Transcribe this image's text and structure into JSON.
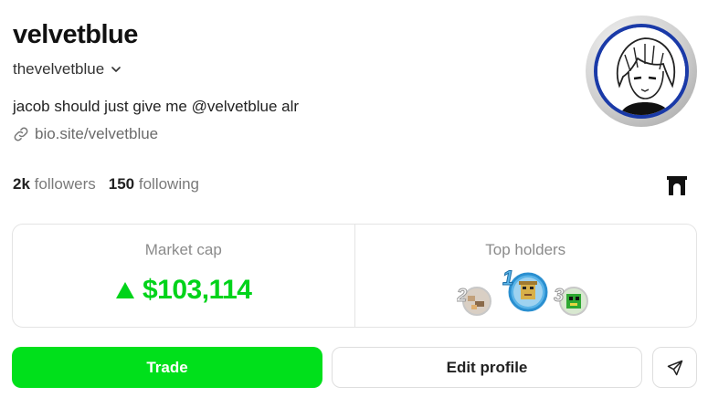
{
  "profile": {
    "display_name": "velvetblue",
    "handle": "thevelvetblue",
    "bio": "jacob should just give me @velvetblue alr",
    "link": "bio.site/velvetblue",
    "followers_count": "2k",
    "followers_label": "followers",
    "following_count": "150",
    "following_label": "following"
  },
  "stats_card": {
    "market_cap_label": "Market cap",
    "market_cap_value": "$103,114",
    "market_cap_trend": "up",
    "top_holders_label": "Top holders",
    "holders": [
      {
        "rank": "2",
        "icon": "pixel-art-avatar"
      },
      {
        "rank": "1",
        "icon": "pixel-art-avatar"
      },
      {
        "rank": "3",
        "icon": "pixel-art-avatar"
      }
    ]
  },
  "actions": {
    "trade_label": "Trade",
    "edit_profile_label": "Edit profile",
    "share_icon": "send-icon"
  },
  "icons": {
    "handle_dropdown": "chevron-down-icon",
    "link": "link-icon",
    "archway": "archway-icon"
  },
  "colors": {
    "accent_green": "#00e01b",
    "price_green": "#00d31a",
    "avatar_ring": "#1a3aa8",
    "muted_text": "#7a7a7a"
  }
}
